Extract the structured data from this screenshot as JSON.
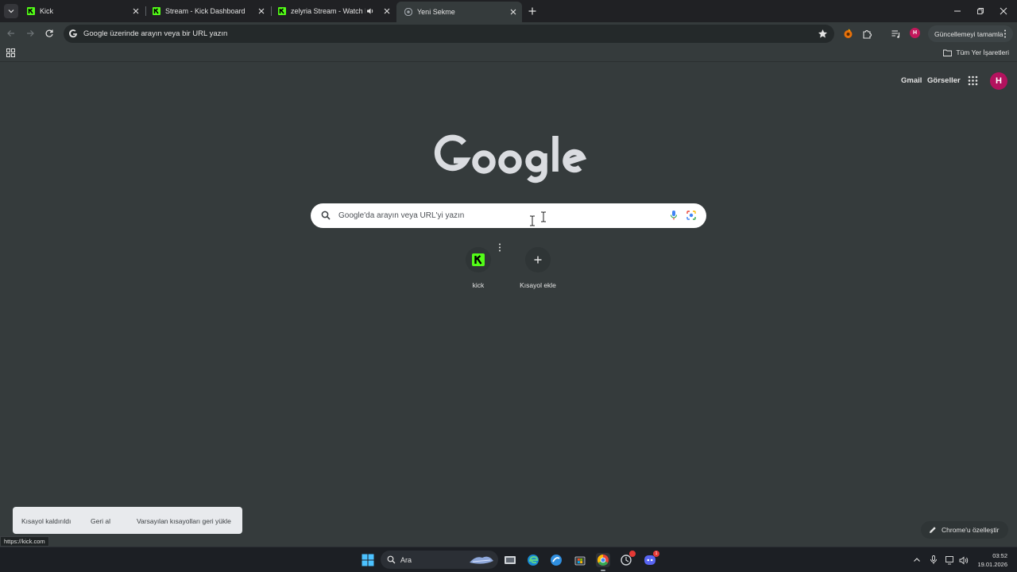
{
  "browser": {
    "tabs": [
      {
        "title": "Kick",
        "icon": "kick-icon"
      },
      {
        "title": "Stream - Kick Dashboard",
        "icon": "kick-icon"
      },
      {
        "title": "zelyria Stream - Watch Live",
        "icon": "kick-icon",
        "audio": true
      },
      {
        "title": "Yeni Sekme",
        "icon": "chrome-icon",
        "active": true
      }
    ],
    "omnibox": {
      "placeholder": "Google üzerinde arayın veya bir URL yazın"
    },
    "update_button": "Güncellemeyi tamamla",
    "profile_initial": "H",
    "bookmarks": {
      "all_bookmarks": "Tüm Yer İşaretleri"
    }
  },
  "ntp": {
    "gmail": "Gmail",
    "images": "Görseller",
    "avatar_initial": "H",
    "search_placeholder": "Google'da arayın veya URL'yi yazın",
    "shortcuts": [
      {
        "label": "kick",
        "icon": "kick-icon"
      },
      {
        "label": "Kısayol ekle",
        "icon": "plus-icon"
      }
    ],
    "toast": {
      "message": "Kısayol kaldırıldı",
      "undo": "Geri al",
      "restore": "Varsayılan kısayolları geri yükle"
    },
    "customize": "Chrome'u özelleştir"
  },
  "status_url": "https://kick.com",
  "taskbar": {
    "search_label": "Ara",
    "time": "03:52",
    "date": "19.01.2026",
    "discord_badge": "1"
  },
  "colors": {
    "kick_green": "#53fc18",
    "page_bg": "#353b3c",
    "avatar": "#b3125e"
  }
}
